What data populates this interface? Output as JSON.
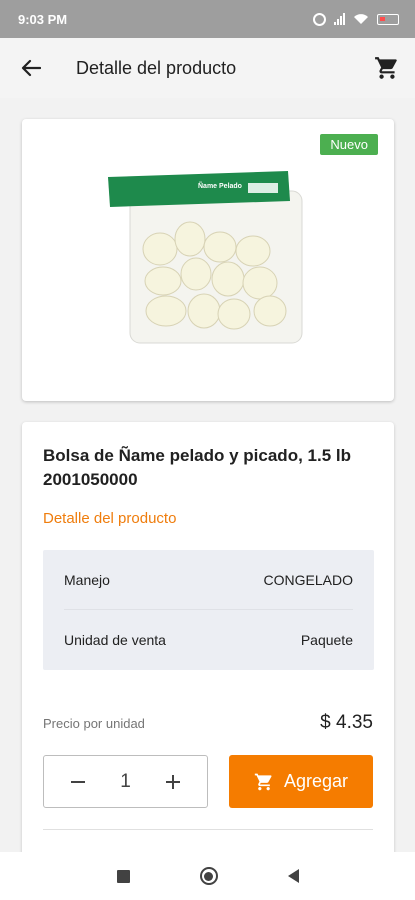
{
  "status_bar": {
    "time": "9:03 PM",
    "icons": [
      "alarm-icon",
      "signal-icon",
      "wifi-icon",
      "battery-icon"
    ]
  },
  "app_bar": {
    "title": "Detalle del producto",
    "back_icon": "arrow-left-icon",
    "cart_icon": "shopping-cart-icon"
  },
  "product": {
    "badge": "Nuevo",
    "name": "Bolsa de Ñame pelado y picado, 1.5 lb",
    "code": "2001050000",
    "section_title": "Detalle del producto",
    "attributes": [
      {
        "label": "Manejo",
        "value": "CONGELADO"
      },
      {
        "label": "Unidad de venta",
        "value": "Paquete"
      }
    ],
    "price_label": "Precio por unidad",
    "price": "$ 4.35",
    "quantity": "1",
    "add_label": "Agregar",
    "package_label": "Ñame Pelado"
  },
  "colors": {
    "accent": "#f57c00",
    "link": "#ef7d0d",
    "badge": "#4caf50",
    "status_bar": "#9e9e9e"
  },
  "nav_bar": {
    "icons": [
      "recent-apps-icon",
      "home-icon",
      "back-triangle-icon"
    ]
  }
}
